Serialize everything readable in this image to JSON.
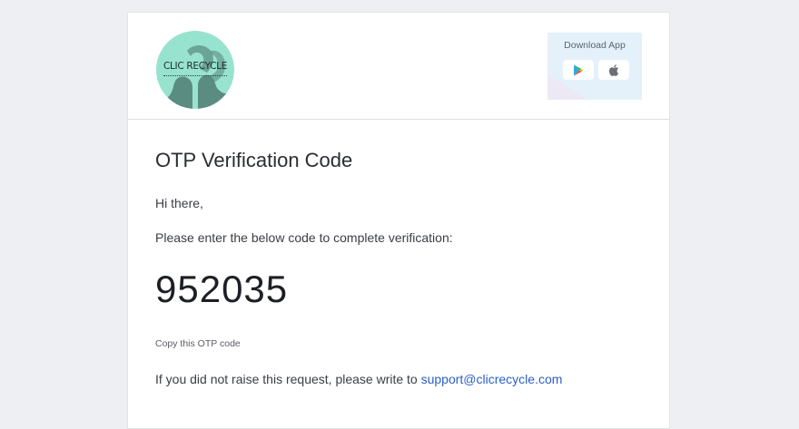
{
  "brand": {
    "logo_text": "CLIC RECYCLE",
    "logo_bg_color": "#98e3cf"
  },
  "download": {
    "title": "Download App",
    "buttons": [
      {
        "icon": "google-play-icon"
      },
      {
        "icon": "apple-icon"
      }
    ]
  },
  "email": {
    "title": "OTP Verification Code",
    "greeting": "Hi there,",
    "instruction": "Please enter the below code to complete verification:",
    "otp_code": "952035",
    "copy_hint": "Copy this OTP code",
    "footer_prefix": "If you did not raise this request, please write to ",
    "support_email": "support@clicrecycle.com"
  },
  "colors": {
    "page_bg": "#eeeff3",
    "link": "#2a5fc4",
    "app_box_bg": "#e4f1fb"
  }
}
